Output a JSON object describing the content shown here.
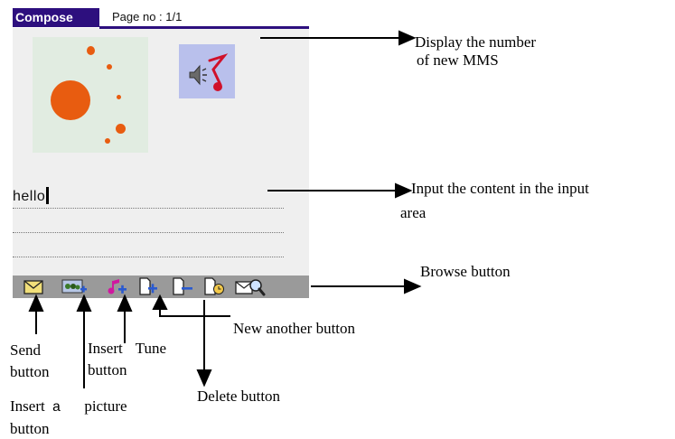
{
  "screen": {
    "tab_title": "Compose",
    "page_label": "Page no : 1/1",
    "input_text": "hello"
  },
  "toolbar": {
    "buttons": [
      {
        "name": "send",
        "icon": "envelope-icon"
      },
      {
        "name": "insert-picture",
        "icon": "insert-picture-icon"
      },
      {
        "name": "insert-tune",
        "icon": "insert-tune-icon"
      },
      {
        "name": "new-another",
        "icon": "new-page-icon"
      },
      {
        "name": "delete",
        "icon": "delete-page-icon"
      },
      {
        "name": "timer",
        "icon": "page-clock-icon"
      },
      {
        "name": "browse",
        "icon": "browse-icon"
      }
    ]
  },
  "annotations": {
    "display_mms": [
      "Display the number",
      "of new MMS"
    ],
    "input_content": [
      "Input the content in the input",
      "area"
    ],
    "browse": "Browse button",
    "new_another": "New another button",
    "send": [
      "Send",
      "button"
    ],
    "insert_tune": [
      "Insert",
      "Tune",
      "button"
    ],
    "insert_picture": [
      "Insert",
      "a",
      "picture",
      "button"
    ],
    "delete": "Delete button"
  },
  "colors": {
    "title_bar": "#2d0f7e",
    "screen_bg": "#efefef",
    "toolbar_bg": "#9a9a9a",
    "image_accent": "#e85c10",
    "tune_bg": "#b9c0ec",
    "tune_note": "#d0102a"
  }
}
